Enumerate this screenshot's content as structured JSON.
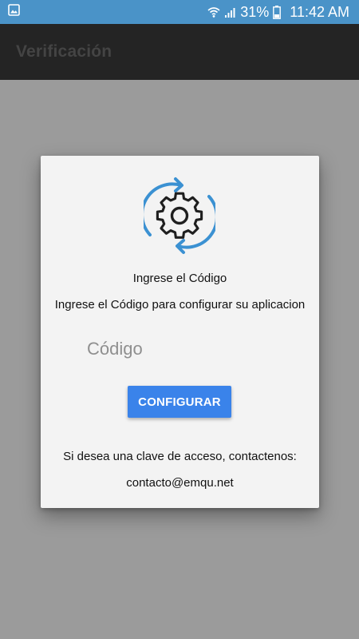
{
  "status_bar": {
    "battery_percent": "31%",
    "time": "11:42 AM",
    "icons": [
      "image-notification-icon",
      "wifi-icon",
      "signal-icon",
      "battery-icon"
    ],
    "color": "#4a93c8"
  },
  "app_bar": {
    "title": "Verificación",
    "color": "#242424"
  },
  "dialog": {
    "icon": "sync-gear-icon",
    "title": "Ingrese el Código",
    "subtitle": "Ingrese el Código para configurar su aplicacion",
    "code_placeholder": "Código",
    "code_value": "",
    "configure_label": "CONFIGURAR",
    "contact_text": "Si desea una clave de acceso, contactenos:",
    "contact_email": "contacto@emqu.net",
    "accent_color": "#3a83ea"
  }
}
